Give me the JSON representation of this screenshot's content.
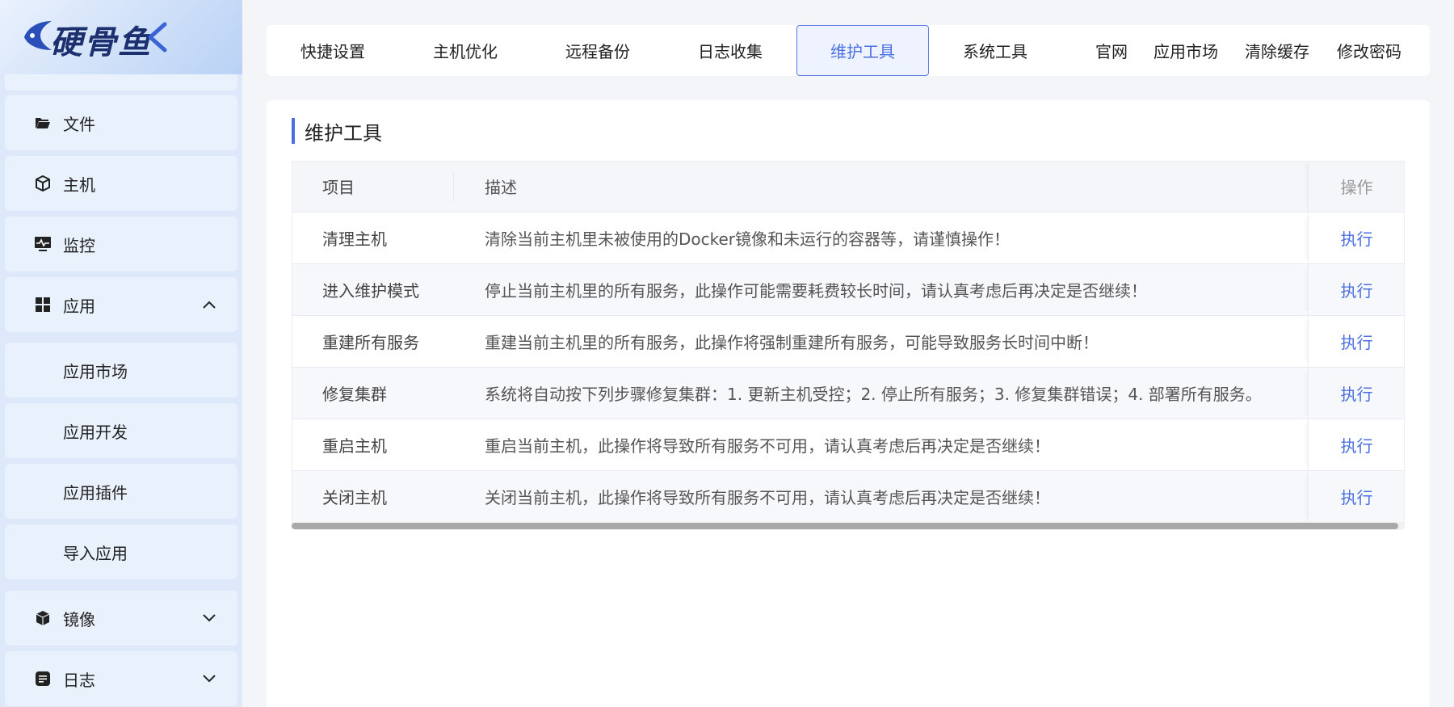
{
  "app": {
    "logo_text": "硬骨鱼",
    "accent_color": "#4a6fe0"
  },
  "sidebar": {
    "items": [
      {
        "label": "文件",
        "icon": "folder-open-icon"
      },
      {
        "label": "主机",
        "icon": "cube-host-icon"
      },
      {
        "label": "监控",
        "icon": "monitor-pulse-icon"
      },
      {
        "label": "应用",
        "icon": "grid-apps-icon",
        "expanded": true
      },
      {
        "label": "应用市场",
        "sub": true
      },
      {
        "label": "应用开发",
        "sub": true
      },
      {
        "label": "应用插件",
        "sub": true
      },
      {
        "label": "导入应用",
        "sub": true
      },
      {
        "label": "镜像",
        "icon": "box-image-icon",
        "expanded": false
      },
      {
        "label": "日志",
        "icon": "log-document-icon",
        "expanded": false
      }
    ]
  },
  "topnav": {
    "tabs": [
      "快捷设置",
      "主机优化",
      "远程备份",
      "日志收集",
      "维护工具",
      "系统工具"
    ],
    "active_tab": "维护工具",
    "links": [
      "官网",
      "应用市场",
      "清除缓存",
      "修改密码"
    ]
  },
  "main": {
    "title": "维护工具",
    "table": {
      "columns": [
        "项目",
        "描述",
        "操作"
      ],
      "rows": [
        {
          "name": "清理主机",
          "desc": "清除当前主机里未被使用的Docker镜像和未运行的容器等，请谨慎操作！",
          "action": "执行"
        },
        {
          "name": "进入维护模式",
          "desc": "停止当前主机里的所有服务，此操作可能需要耗费较长时间，请认真考虑后再决定是否继续！",
          "action": "执行"
        },
        {
          "name": "重建所有服务",
          "desc": "重建当前主机里的所有服务，此操作将强制重建所有服务，可能导致服务长时间中断！",
          "action": "执行"
        },
        {
          "name": "修复集群",
          "desc": "系统将自动按下列步骤修复集群：1. 更新主机受控；2. 停止所有服务；3. 修复集群错误；4. 部署所有服务。",
          "action": "执行"
        },
        {
          "name": "重启主机",
          "desc": "重启当前主机，此操作将导致所有服务不可用，请认真考虑后再决定是否继续！",
          "action": "执行"
        },
        {
          "name": "关闭主机",
          "desc": "关闭当前主机，此操作将导致所有服务不可用，请认真考虑后再决定是否继续！",
          "action": "执行"
        }
      ]
    }
  }
}
